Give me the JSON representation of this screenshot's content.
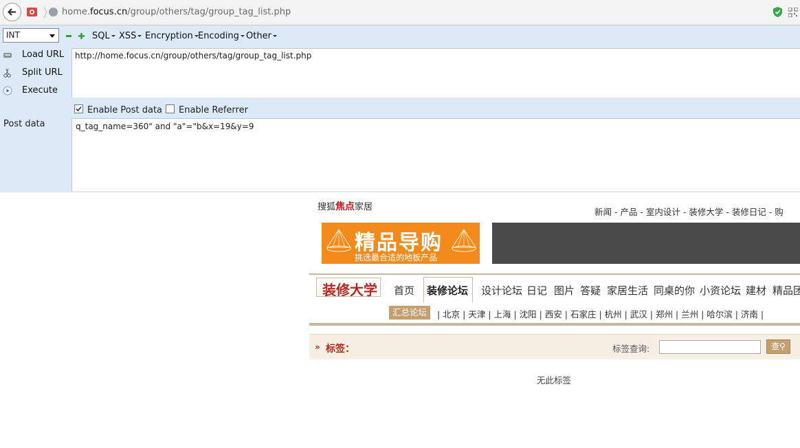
{
  "browser": {
    "url_prefix": "home.",
    "url_domain": "focus.cn",
    "url_path": "/group/others/tag/group_tag_list.php"
  },
  "hackbar": {
    "type_select": "INT",
    "menus": [
      "SQL",
      "XSS",
      "Encryption",
      "Encoding",
      "Other"
    ],
    "load_url": "Load URL",
    "split_url": "Split URL",
    "execute": "Execute",
    "url_value": "http://home.focus.cn/group/others/tag/group_tag_list.php",
    "enable_post_label": "Enable Post data",
    "enable_post_checked": true,
    "enable_referrer_label": "Enable Referrer",
    "enable_referrer_checked": false,
    "post_label": "Post data",
    "post_value": "q_tag_name=360\" and \"a\"=\"b&x=19&y=9"
  },
  "site": {
    "logo_left": "搜狐",
    "logo_mid": "焦点",
    "logo_right": "家居",
    "top_nav": "新闻 - 产品 - 室内设计 - 装修大学 - 装修日记 - 购",
    "banner_title": "精品导购",
    "banner_sub": "挑选最合适的地板产品",
    "brand": "装修大学",
    "nav": [
      "首页",
      "装修论坛",
      "设计论坛",
      "日记",
      "图片",
      "答疑",
      "家居生活",
      "同桌的你",
      "小资论坛",
      "建材",
      "精品团"
    ],
    "sub_active": "汇总论坛",
    "sub_cities": "| 北京 | 天津 | 上海 | 沈阳 | 西安 | 石家庄 | 杭州 | 武汉 | 郑州 | 兰州 | 哈尔滨 | 济南 |",
    "tag_label": "标签：",
    "tag_query_label": "标签查询:",
    "tag_query_button": "查",
    "no_tags": "无此标签"
  }
}
